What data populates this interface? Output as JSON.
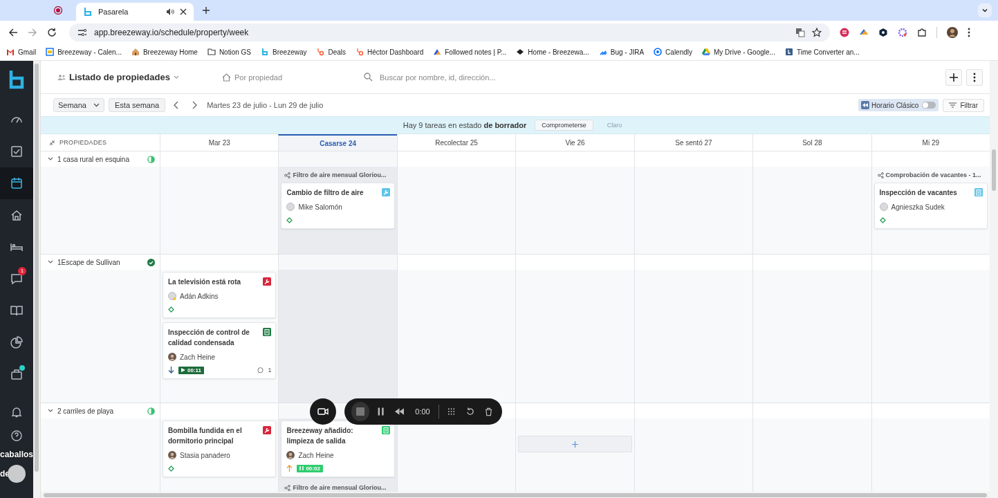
{
  "browser": {
    "tabs": [
      {
        "title": "Pasarela",
        "selected": true,
        "audio": true
      }
    ],
    "url": "app.breezeway.io/schedule/property/week",
    "bookmarks": [
      {
        "label": "Gmail",
        "kind": "mail"
      },
      {
        "label": "Breezeway - Calen...",
        "kind": "calendar"
      },
      {
        "label": "Breezeway Home",
        "kind": "house"
      },
      {
        "label": "Notion GS",
        "kind": "folder"
      },
      {
        "label": "Breezeway",
        "kind": "logo"
      },
      {
        "label": "Deals",
        "kind": "sprocket"
      },
      {
        "label": "Héctor Dashboard",
        "kind": "sprocket"
      },
      {
        "label": "Followed notes | P...",
        "kind": "arrow"
      },
      {
        "label": "Home - Breezewa...",
        "kind": "diamond"
      },
      {
        "label": "Bug - JIRA",
        "kind": "stack"
      },
      {
        "label": "Calendly",
        "kind": "ring"
      },
      {
        "label": "My Drive - Google...",
        "kind": "triangle"
      },
      {
        "label": "Time Converter an...",
        "kind": "clock"
      }
    ]
  },
  "sidebar": {
    "items": [
      {
        "kind": "gauge",
        "selected": false
      },
      {
        "kind": "tasks",
        "selected": false
      },
      {
        "kind": "calendar",
        "selected": true
      },
      {
        "kind": "home",
        "selected": false
      },
      {
        "kind": "bed",
        "selected": false
      },
      {
        "kind": "chat",
        "selected": false,
        "badge": "1"
      },
      {
        "kind": "book",
        "selected": false
      },
      {
        "kind": "pie",
        "selected": false
      },
      {
        "kind": "bag",
        "selected": false,
        "dot": true
      }
    ]
  },
  "header": {
    "title": "Listado de propiedades",
    "view": "Por propiedad",
    "search_placeholder": "Buscar por nombre, id, dirección..."
  },
  "toolbar": {
    "range": "Semana",
    "today": "Esta semana",
    "period": "Martes 23 de julio - Lun 29 de julio",
    "classic": {
      "label": "Horario Clásico",
      "on": false
    },
    "filter": "Filtrar"
  },
  "banner": {
    "text": "Hay 9 tareas en estado **de borrador**",
    "commit": "Comprometerse",
    "clear": "Claro"
  },
  "grid": {
    "first_column": "PROPIEDADES",
    "days": [
      {
        "label": "Mar 23",
        "selected": false
      },
      {
        "label": "Casarse 24",
        "selected": true
      },
      {
        "label": "Recolectar 25",
        "selected": false
      },
      {
        "label": "Vie 26",
        "selected": false
      },
      {
        "label": "Se sentó 27",
        "selected": false
      },
      {
        "label": "Sol 28",
        "selected": false
      },
      {
        "label": "Mi 29",
        "selected": false
      }
    ]
  },
  "properties": [
    {
      "name": "1 casa rural en esquina",
      "complete": false,
      "cells": [
        [],
        [
          {
            "kind": "group",
            "label": "Filtro de aire mensual Gloriou..."
          },
          {
            "kind": "task",
            "title": "Cambio de filtro de aire",
            "assignee": "Mike Salomón",
            "photo": false,
            "away": false,
            "tag": {
              "kind": "wrench",
              "color": "#5cc4ea"
            },
            "priority": {
              "kind": "none"
            }
          }
        ],
        [],
        [],
        [],
        [],
        [
          {
            "kind": "group",
            "label": "Comprobación de vacantes - 1..."
          },
          {
            "kind": "task",
            "title": "Inspección de vacantes",
            "assignee": "Agnieszka Sudek",
            "photo": false,
            "away": false,
            "tag": {
              "kind": "clipboard",
              "color": "#5cc4ea"
            },
            "priority": {
              "kind": "none"
            }
          }
        ]
      ]
    },
    {
      "name": "1Escape de Sullivan",
      "complete": true,
      "cells": [
        [
          {
            "kind": "task",
            "title": "La televisión está rota",
            "assignee": "Adán Adkins",
            "photo": false,
            "away": true,
            "tag": {
              "kind": "wrench",
              "color": "#d7263d"
            },
            "priority": {
              "kind": "none"
            }
          },
          {
            "kind": "task",
            "title": "Inspección de control de calidad condensada",
            "assignee": "Zach Heine",
            "photo": true,
            "away": false,
            "tag": {
              "kind": "clipboard",
              "color": "#1e7b45"
            },
            "priority": {
              "kind": "down"
            },
            "timer": {
              "text": "00:11",
              "running": true
            },
            "comments": "1"
          }
        ],
        [],
        [],
        [],
        [],
        [],
        []
      ]
    },
    {
      "name": "2 carriles de playa",
      "complete": false,
      "cells": [
        [
          {
            "kind": "task",
            "title": "Bombilla fundida en el dormitorio principal",
            "assignee": "Stasia panadero",
            "photo": true,
            "away": false,
            "tag": {
              "kind": "wrench",
              "color": "#d7263d"
            },
            "priority": {
              "kind": "none"
            }
          }
        ],
        [
          {
            "kind": "task",
            "title": "Breezeway añadido: limpieza de salida",
            "assignee": "Zach Heine",
            "photo": true,
            "away": false,
            "tag": {
              "kind": "clipboard",
              "color": "#2ecc71"
            },
            "priority": {
              "kind": "up"
            },
            "timer": {
              "text": "00:02",
              "running": false
            }
          },
          {
            "kind": "group",
            "label": "Filtro de aire mensual Gloriou..."
          }
        ],
        [],
        [
          {
            "kind": "add"
          }
        ],
        [],
        [],
        []
      ]
    }
  ],
  "recorder": {
    "time": "0:00"
  },
  "overlay_caption": [
    "caballos",
    "de"
  ]
}
